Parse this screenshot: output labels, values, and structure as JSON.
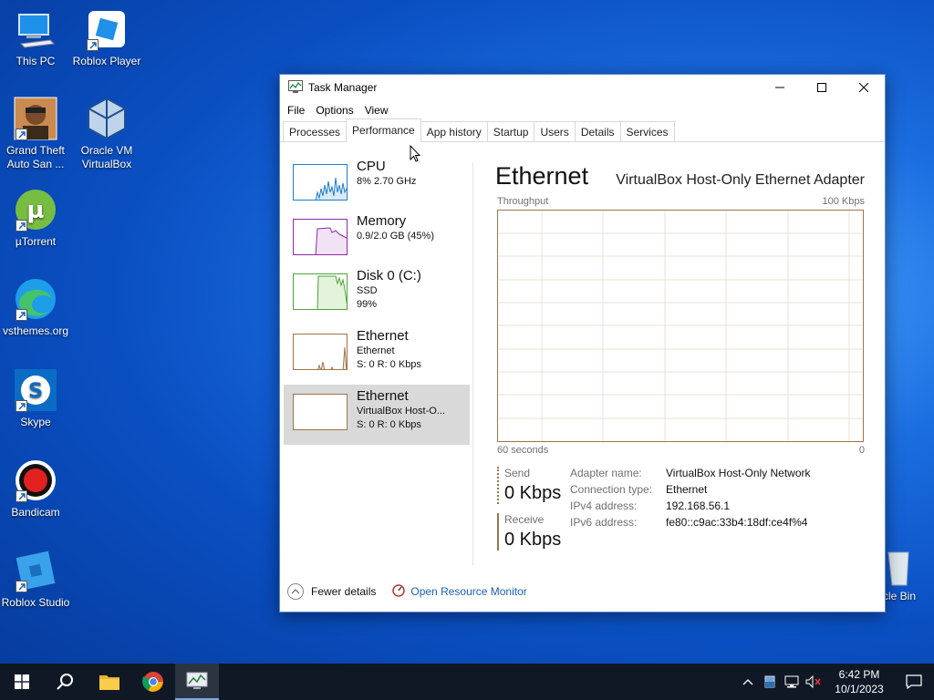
{
  "desktop": {
    "icons": [
      {
        "label": "This PC",
        "icon": "this-pc-icon"
      },
      {
        "label": "Roblox Player",
        "icon": "roblox-player-icon"
      },
      {
        "label": "Grand Theft Auto San ...",
        "icon": "gta-icon"
      },
      {
        "label": "Oracle VM VirtualBox",
        "icon": "virtualbox-icon"
      },
      {
        "label": "µTorrent",
        "icon": "utorrent-icon"
      },
      {
        "label": "vsthemes.org",
        "icon": "edge-icon"
      },
      {
        "label": "Skype",
        "icon": "skype-icon"
      },
      {
        "label": "Bandicam",
        "icon": "bandicam-icon"
      },
      {
        "label": "Roblox Studio",
        "icon": "roblox-studio-icon"
      }
    ],
    "recycle_bin_label": "cle Bin"
  },
  "window": {
    "title": "Task Manager",
    "menu": [
      "File",
      "Options",
      "View"
    ],
    "tabs": [
      "Processes",
      "Performance",
      "App history",
      "Startup",
      "Users",
      "Details",
      "Services"
    ],
    "active_tab": "Performance",
    "resources": [
      {
        "name": "CPU",
        "line1": "8%  2.70 GHz",
        "line2": "",
        "color": "#1c7ec9"
      },
      {
        "name": "Memory",
        "line1": "0.9/2.0 GB (45%)",
        "line2": "",
        "color": "#8e2aa8"
      },
      {
        "name": "Disk 0 (C:)",
        "line1": "SSD",
        "line2": "99%",
        "color": "#4da33a"
      },
      {
        "name": "Ethernet",
        "line1": "Ethernet",
        "line2": "S: 0  R: 0 Kbps",
        "color": "#a0744a"
      },
      {
        "name": "Ethernet",
        "line1": "VirtualBox Host-O...",
        "line2": "S: 0  R: 0 Kbps",
        "color": "#a0744a"
      }
    ],
    "detail": {
      "title": "Ethernet",
      "adapter": "VirtualBox Host-Only Ethernet Adapter",
      "graph_label": "Throughput",
      "graph_max": "100 Kbps",
      "graph_time": "60 seconds",
      "graph_min": "0",
      "send_label": "Send",
      "send_value": "0 Kbps",
      "receive_label": "Receive",
      "receive_value": "0 Kbps",
      "properties": [
        {
          "key": "Adapter name:",
          "value": "VirtualBox Host-Only Network"
        },
        {
          "key": "Connection type:",
          "value": "Ethernet"
        },
        {
          "key": "IPv4 address:",
          "value": "192.168.56.1"
        },
        {
          "key": "IPv6 address:",
          "value": "fe80::c9ac:33b4:18df:ce4f%4"
        }
      ]
    },
    "footer": {
      "fewer_details": "Fewer details",
      "open_resource_monitor": "Open Resource Monitor"
    }
  },
  "taskbar": {
    "time": "6:42 PM",
    "date": "10/1/2023"
  }
}
